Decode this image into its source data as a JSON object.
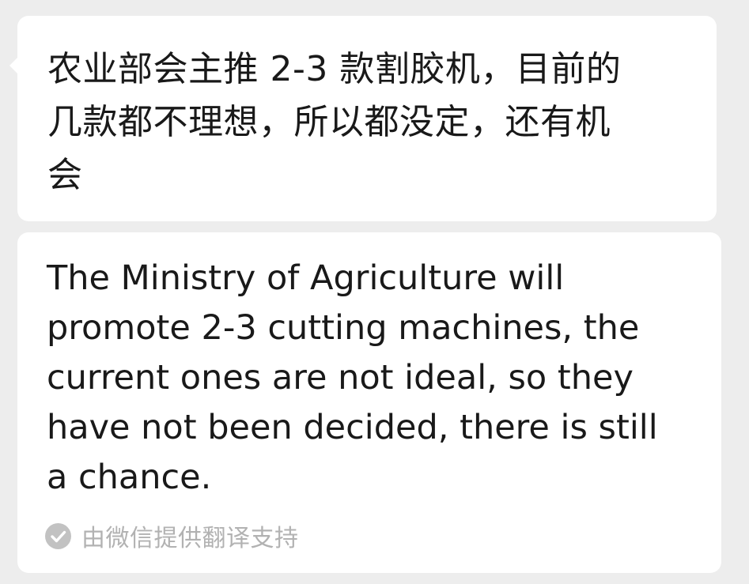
{
  "message": {
    "original_text": "农业部会主推 2-3 款割胶机，目前的\n几款都不理想，所以都没定，还有机\n会"
  },
  "translation": {
    "text": "The Ministry of Agriculture will\npromote 2-3 cutting machines, the\ncurrent ones are not ideal, so they\nhave not been decided, there is still\na chance.",
    "attribution_icon": "check-circle-icon",
    "attribution_text": "由微信提供翻译支持"
  },
  "colors": {
    "background": "#ededed",
    "bubble": "#ffffff",
    "text": "#191919",
    "attribution": "#b2b2b2"
  }
}
